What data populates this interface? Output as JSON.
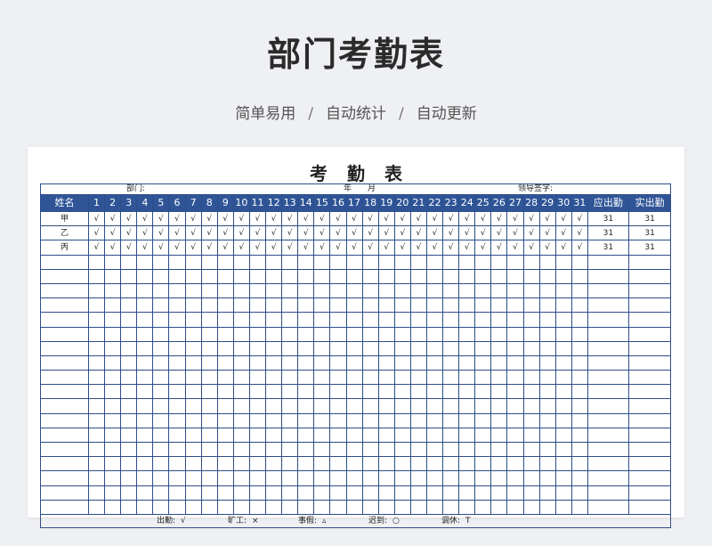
{
  "page": {
    "title": "部门考勤表",
    "tags": [
      "简单易用",
      "自动统计",
      "自动更新"
    ],
    "separator": "/"
  },
  "sheet": {
    "title": "考勤表",
    "info": {
      "dept": "部门:",
      "year_month": "年　　月",
      "signature": "领导签字:"
    },
    "headers": {
      "name": "姓名",
      "days": [
        "1",
        "2",
        "3",
        "4",
        "5",
        "6",
        "7",
        "8",
        "9",
        "10",
        "11",
        "12",
        "13",
        "14",
        "15",
        "16",
        "17",
        "18",
        "19",
        "20",
        "21",
        "22",
        "23",
        "24",
        "25",
        "26",
        "27",
        "28",
        "29",
        "30",
        "31"
      ],
      "expected": "应出勤",
      "actual": "实出勤"
    },
    "rows": [
      {
        "name": "甲",
        "mark": "√",
        "expected": "31",
        "actual": "31"
      },
      {
        "name": "乙",
        "mark": "√",
        "expected": "31",
        "actual": "31"
      },
      {
        "name": "丙",
        "mark": "√",
        "expected": "31",
        "actual": "31"
      }
    ],
    "empty_rows": 18,
    "legend": [
      {
        "label": "出勤:",
        "symbol": "√"
      },
      {
        "label": "旷工:",
        "symbol": "×"
      },
      {
        "label": "事假:",
        "symbol": "▵"
      },
      {
        "label": "迟到:",
        "symbol": "○"
      },
      {
        "label": "调休:",
        "symbol": "T"
      }
    ]
  },
  "colors": {
    "header_bg": "#2f5597",
    "grid_line": "#2d4d8b",
    "page_bg": "#eff0f3"
  }
}
